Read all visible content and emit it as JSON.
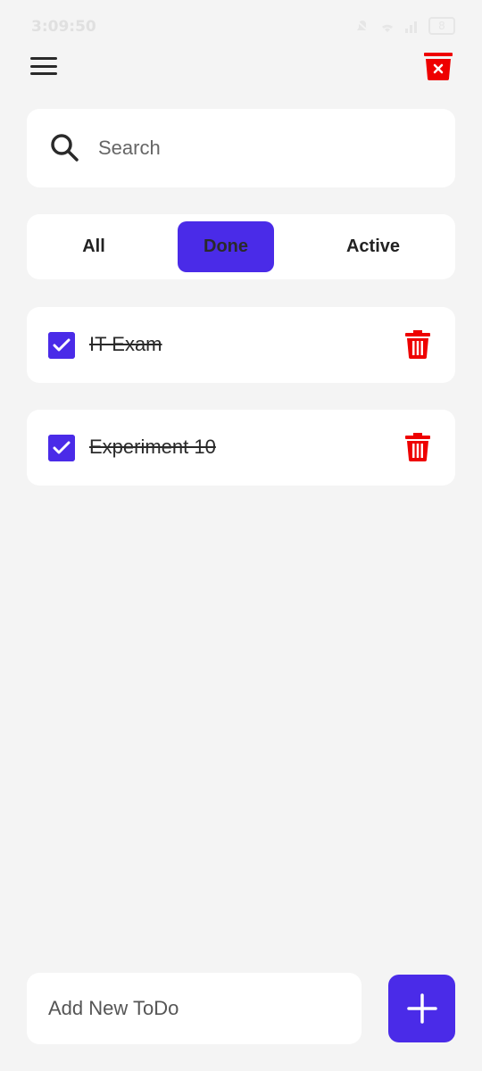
{
  "status_bar": {
    "time": "3:09:50",
    "battery": "8"
  },
  "header": {
    "menu_icon": "hamburger-menu-icon",
    "clear_icon": "delete-all-icon",
    "accent_color": "#ee0000"
  },
  "search": {
    "placeholder": "Search",
    "value": ""
  },
  "tabs": [
    {
      "label": "All",
      "selected": false
    },
    {
      "label": "Done",
      "selected": true
    },
    {
      "label": "Active",
      "selected": false
    }
  ],
  "todos": [
    {
      "title": "IT Exam",
      "done": true
    },
    {
      "title": "Experiment 10",
      "done": true
    }
  ],
  "add_todo": {
    "placeholder": "Add New ToDo",
    "value": "",
    "button_icon": "plus-icon"
  },
  "colors": {
    "primary": "#4a2be8",
    "danger": "#ee0000",
    "background": "#f4f4f4"
  }
}
